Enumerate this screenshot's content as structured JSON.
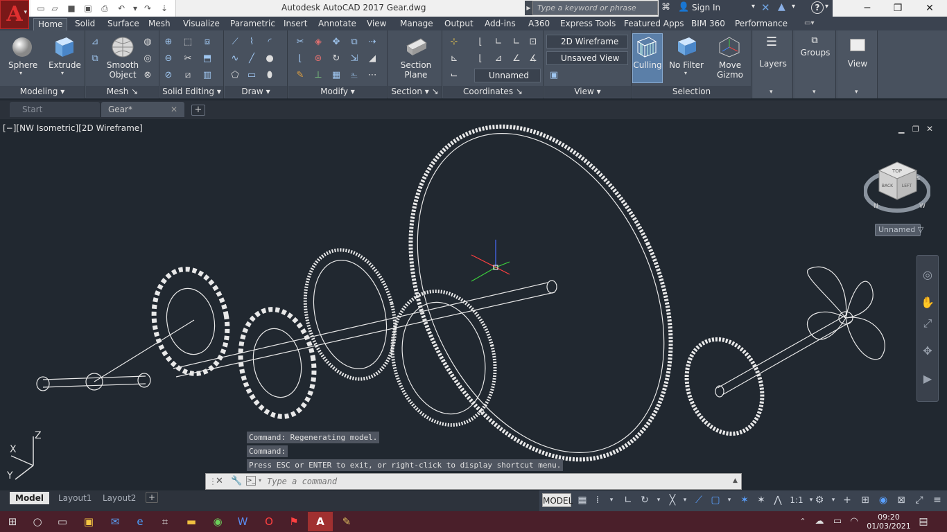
{
  "titlebar": {
    "app_letter": "A",
    "title": "Autodesk AutoCAD 2017    Gear.dwg",
    "search_placeholder": "Type a keyword or phrase",
    "signin": "Sign In",
    "help": "?"
  },
  "ribbon": {
    "tabs": [
      "Home",
      "Solid",
      "Surface",
      "Mesh",
      "Visualize",
      "Parametric",
      "Insert",
      "Annotate",
      "View",
      "Manage",
      "Output",
      "Add-ins",
      "A360",
      "Express Tools",
      "Featured Apps",
      "BIM 360",
      "Performance"
    ],
    "active_tab": "Home",
    "buttons": {
      "sphere": "Sphere",
      "extrude": "Extrude",
      "smooth_object": "Smooth Object",
      "section_plane": "Section Plane",
      "culling": "Culling",
      "no_filter": "No Filter",
      "move_gizmo": "Move Gizmo",
      "layers": "Layers",
      "groups": "Groups",
      "view": "View"
    },
    "dropdowns": {
      "visual_style": "2D Wireframe",
      "saved_view": "Unsaved View",
      "ucs": "Unnamed"
    },
    "panels": [
      "Modeling",
      "Mesh",
      "Solid Editing",
      "Draw",
      "Modify",
      "Section",
      "Coordinates",
      "View",
      "Selection"
    ]
  },
  "filetabs": {
    "start": "Start",
    "gear": "Gear*"
  },
  "viewport": {
    "label": "[−][NW Isometric][2D Wireframe]",
    "viewcube_top": "TOP",
    "viewcube_back": "BACK",
    "viewcube_left": "LEFT",
    "compass_n": "N",
    "compass_w": "W",
    "compass_s": "S",
    "ucs_label": "Unnamed",
    "ucs_axis_x": "X",
    "ucs_axis_y": "Y",
    "ucs_axis_z": "Z"
  },
  "command": {
    "history": [
      "Command:  Regenerating model.",
      "Command:",
      "Press ESC or ENTER to exit, or right-click to display shortcut menu."
    ],
    "input_placeholder": "Type a command"
  },
  "layout_tabs": [
    "Model",
    "Layout1",
    "Layout2"
  ],
  "status": {
    "model": "MODEL",
    "scale": "1:1"
  },
  "taskbar": {
    "time": "09:20",
    "date": "01/03/2021"
  },
  "colors": {
    "viewport_bg": "#212830",
    "ribbon_bg": "#48515e",
    "taskbar_bg": "#4a1f2a",
    "accent": "#c02a2a"
  }
}
